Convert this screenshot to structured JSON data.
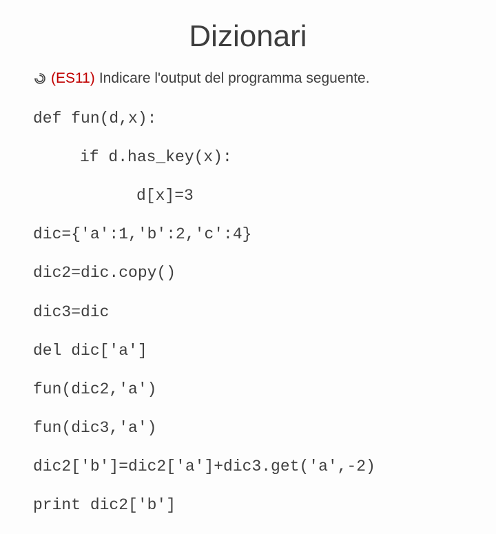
{
  "title": "Dizionari",
  "prompt": {
    "es_label": "(ES11)",
    "text": "Indicare l'output del programma seguente."
  },
  "code": {
    "l01": "def fun(d,x):",
    "l02": "if d.has_key(x):",
    "l03": "d[x]=3",
    "l04": "dic={'a':1,'b':2,'c':4}",
    "l05": "dic2=dic.copy()",
    "l06": "dic3=dic",
    "l07": "del dic['a']",
    "l08": "fun(dic2,'a')",
    "l09": "fun(dic3,'a')",
    "l10": "dic2['b']=dic2['a']+dic3.get('a',-2)",
    "l11": "print dic2['b']"
  }
}
